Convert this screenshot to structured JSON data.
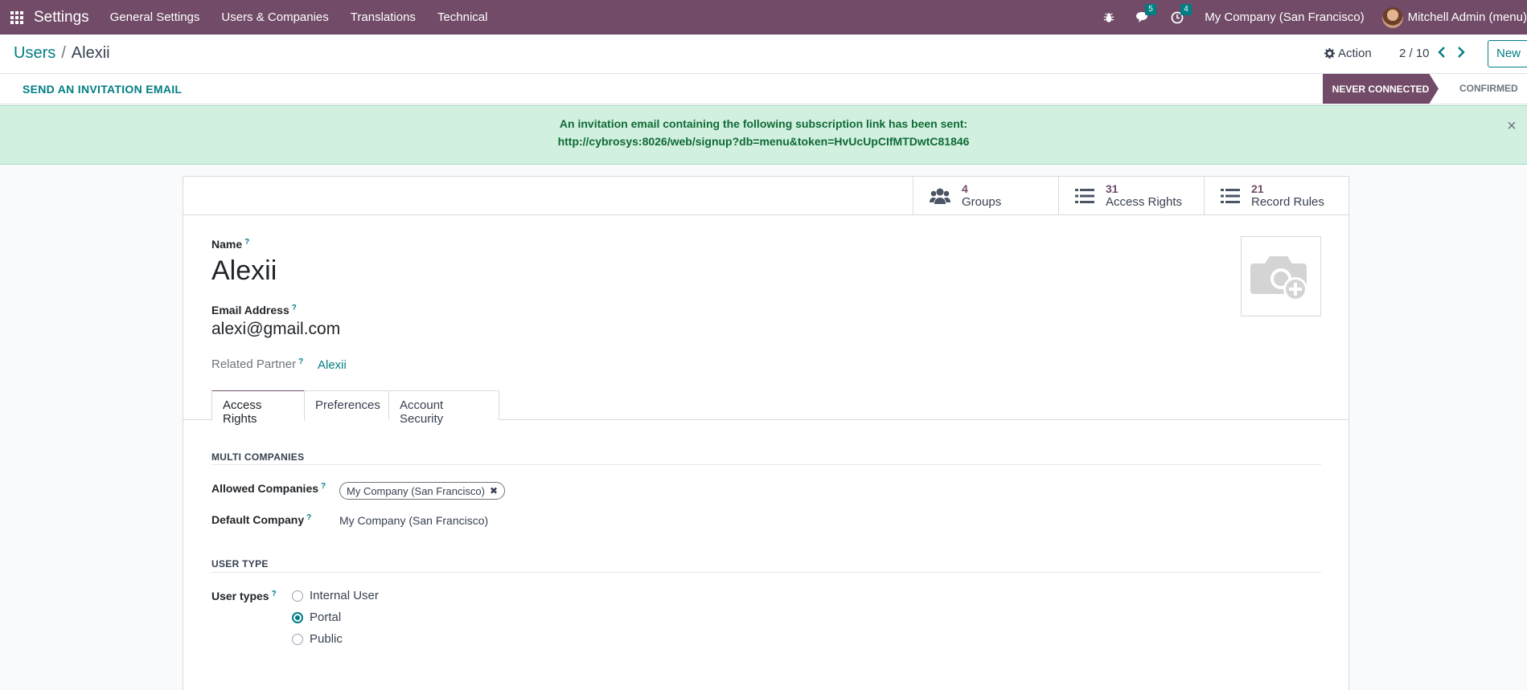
{
  "navbar": {
    "app_name": "Settings",
    "menus": [
      "General Settings",
      "Users & Companies",
      "Translations",
      "Technical"
    ],
    "messages_count": "5",
    "activities_count": "4",
    "company": "My Company (San Francisco)",
    "user": "Mitchell Admin (menu)"
  },
  "control_panel": {
    "breadcrumb_parent": "Users",
    "breadcrumb_sep": "/",
    "breadcrumb_current": "Alexii",
    "action_label": "Action",
    "pager": "2 / 10",
    "new_label": "New"
  },
  "statusbar": {
    "invite_label": "SEND AN INVITATION EMAIL",
    "stage_active": "NEVER CONNECTED",
    "stage_next": "CONFIRMED"
  },
  "alert": {
    "line1": "An invitation email containing the following subscription link has been sent:",
    "line2": "http://cybrosys:8026/web/signup?db=menu&token=HvUcUpCIfMTDwtC81846",
    "close": "×"
  },
  "stats": [
    {
      "value": "4",
      "label": "Groups"
    },
    {
      "value": "31",
      "label": "Access Rights"
    },
    {
      "value": "21",
      "label": "Record Rules"
    }
  ],
  "form": {
    "name_label": "Name",
    "name_value": "Alexii",
    "email_label": "Email Address",
    "email_value": "alexi@gmail.com",
    "partner_label": "Related Partner",
    "partner_value": "Alexii",
    "help_mark": "?"
  },
  "tabs": [
    "Access Rights",
    "Preferences",
    "Account Security"
  ],
  "multi_companies": {
    "title": "MULTI COMPANIES",
    "allowed_label": "Allowed Companies",
    "allowed_tag": "My Company (San Francisco)",
    "tag_remove": "✖",
    "default_label": "Default Company",
    "default_value": "My Company (San Francisco)"
  },
  "user_type": {
    "title": "USER TYPE",
    "label": "User types",
    "options": [
      "Internal User",
      "Portal",
      "Public"
    ],
    "selected": "Portal"
  },
  "colors": {
    "brand": "#714b67",
    "accent": "#017e84",
    "alert_bg": "#d1f0e0"
  }
}
